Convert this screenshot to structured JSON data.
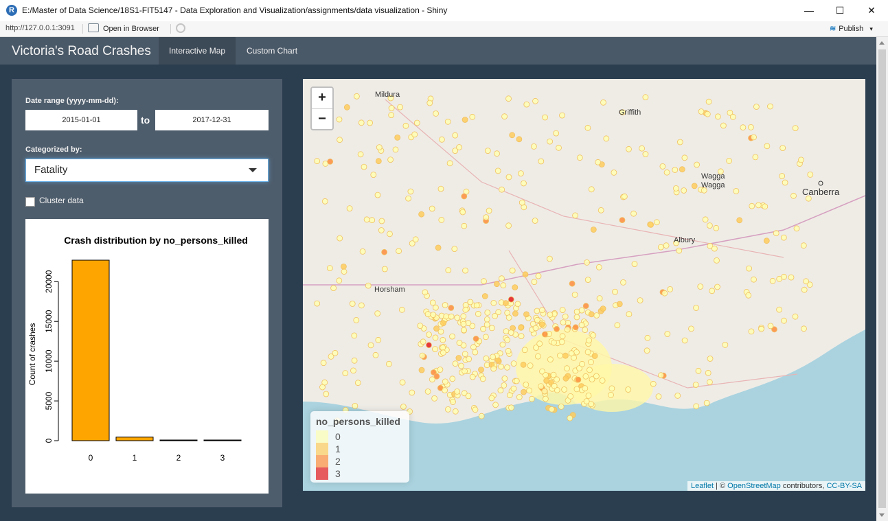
{
  "window": {
    "title": "E:/Master of Data Science/18S1-FIT5147 - Data Exploration and Visualization/assignments/data visualization - Shiny",
    "app_icon": "R",
    "minimize": "—",
    "maximize": "☐",
    "close": "✕"
  },
  "toolbar": {
    "url": "http://127.0.0.1:3091",
    "open_browser": "Open in Browser",
    "publish": "Publish",
    "publish_icon": "≋",
    "publish_caret": "▾"
  },
  "navbar": {
    "brand": "Victoria's Road Crashes",
    "tabs": [
      {
        "label": "Interactive Map",
        "active": true
      },
      {
        "label": "Custom Chart",
        "active": false
      }
    ]
  },
  "sidebar": {
    "date_label": "Date range (yyyy-mm-dd):",
    "date_start": "2015-01-01",
    "date_sep": "to",
    "date_end": "2017-12-31",
    "category_label": "Categorized by:",
    "category_value": "Fatality",
    "cluster_label": "Cluster data",
    "cluster_checked": false
  },
  "chart_data": {
    "type": "bar",
    "title": "Crash distribution by no_persons_killed",
    "ylabel": "Count of crashes",
    "xlabel": "",
    "categories": [
      "0",
      "1",
      "2",
      "3"
    ],
    "values": [
      22700,
      450,
      35,
      10
    ],
    "ylim": [
      0,
      22700
    ],
    "yticks": [
      0,
      5000,
      10000,
      15000,
      20000
    ],
    "bar_color": "#FFA500"
  },
  "map": {
    "zoom_in": "+",
    "zoom_out": "−",
    "places": [
      {
        "name": "Mildura"
      },
      {
        "name": "Griffith"
      },
      {
        "name": "Wagga"
      },
      {
        "name": "Wagga"
      },
      {
        "name": "Canberra"
      },
      {
        "name": "Albury"
      },
      {
        "name": "Horsham"
      }
    ],
    "legend": {
      "title": "no_persons_killed",
      "items": [
        {
          "label": "0",
          "color": "#ffffb2"
        },
        {
          "label": "1",
          "color": "#fecc5c"
        },
        {
          "label": "2",
          "color": "#fd8d3c"
        },
        {
          "label": "3",
          "color": "#e31a1c"
        }
      ]
    },
    "attribution": {
      "leaflet": "Leaflet",
      "sep": " | © ",
      "osm": "OpenStreetMap",
      "contributors": " contributors, ",
      "license": "CC-BY-SA"
    }
  }
}
